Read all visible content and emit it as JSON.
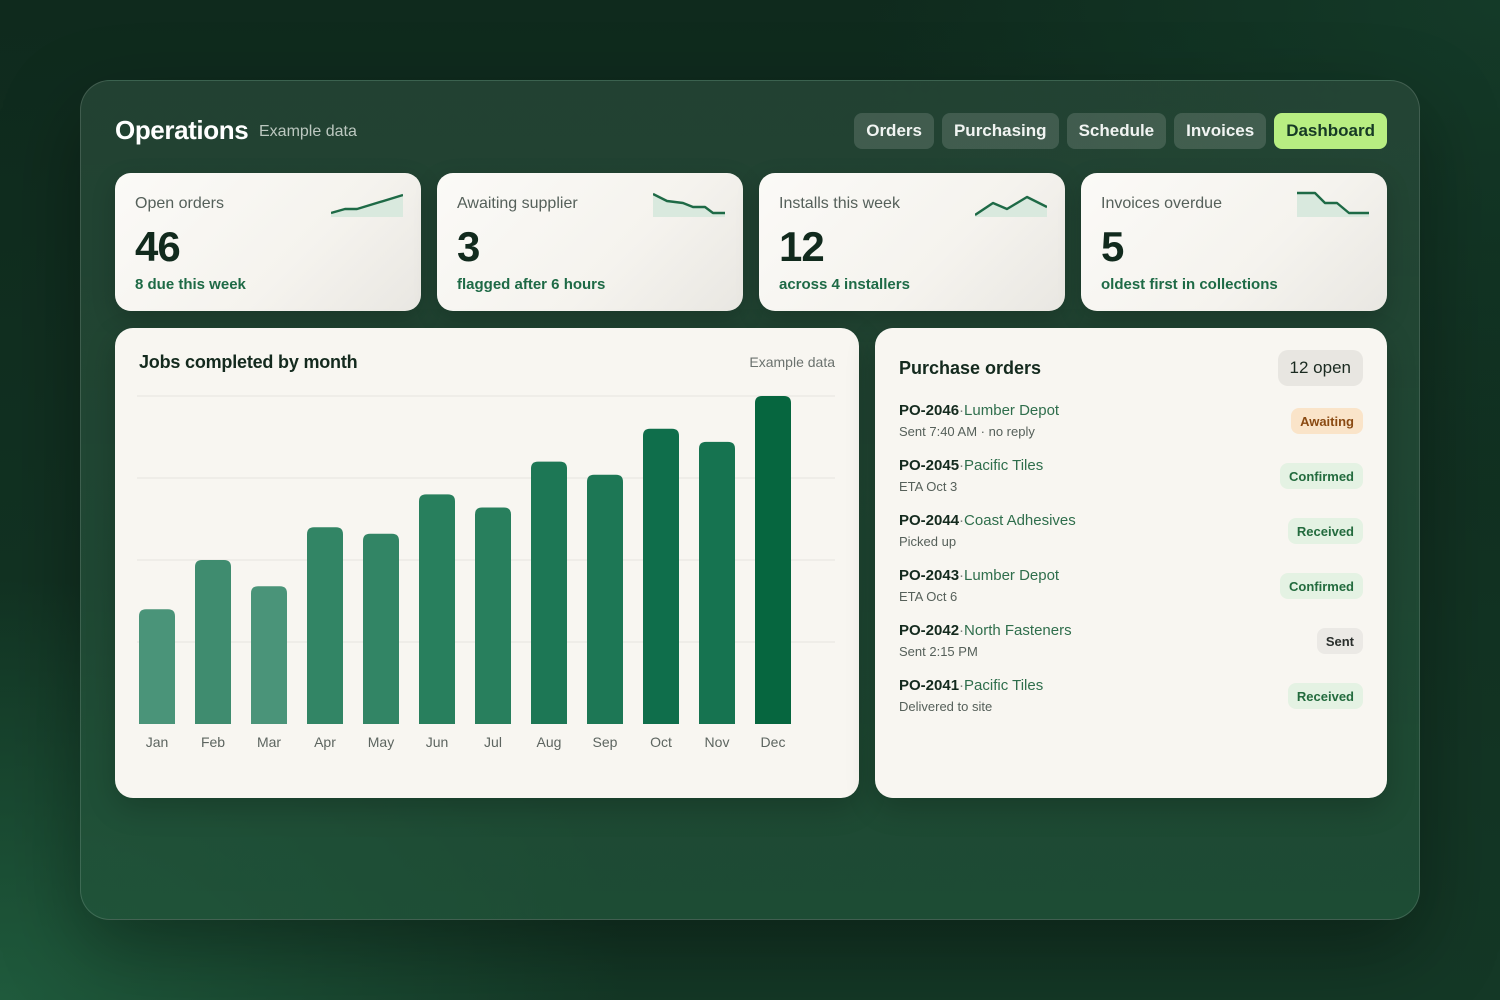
{
  "header": {
    "title": "Operations",
    "subtitle": "Example data",
    "tabs": [
      "Orders",
      "Purchasing",
      "Schedule",
      "Invoices",
      "Dashboard"
    ],
    "active_tab": "Dashboard"
  },
  "stats": [
    {
      "label": "Open orders",
      "value": "46",
      "note": "8 due this week",
      "trend": "up"
    },
    {
      "label": "Awaiting supplier",
      "value": "3",
      "note": "flagged after 6 hours",
      "trend": "down"
    },
    {
      "label": "Installs this week",
      "value": "12",
      "note": "across 4 installers",
      "trend": "wave"
    },
    {
      "label": "Invoices overdue",
      "value": "5",
      "note": "oldest first in collections",
      "trend": "down"
    }
  ],
  "chart": {
    "title": "Jobs completed by month",
    "tag": "Example data"
  },
  "chart_data": {
    "type": "bar",
    "categories": [
      "Jan",
      "Feb",
      "Mar",
      "Apr",
      "May",
      "Jun",
      "Jul",
      "Aug",
      "Sep",
      "Oct",
      "Nov",
      "Dec"
    ],
    "values": [
      35,
      50,
      42,
      60,
      58,
      70,
      66,
      80,
      76,
      90,
      86,
      100
    ],
    "ylim": [
      0,
      100
    ],
    "grid": true,
    "colors": [
      "#4a9479",
      "#3f8c6f",
      "#4a9479",
      "#328565",
      "#328565",
      "#287f5d",
      "#287f5d",
      "#1d7755",
      "#1d7755",
      "#0f6e4b",
      "#167350",
      "#06663f"
    ]
  },
  "purchase_orders": {
    "title": "Purchase orders",
    "count": "12 open",
    "items": [
      {
        "id": "PO-2046",
        "supplier": "Lumber Depot",
        "detail": "Sent 7:40 AM · no reply",
        "status": "Awaiting",
        "tone": "awaiting"
      },
      {
        "id": "PO-2045",
        "supplier": "Pacific Tiles",
        "detail": "ETA Oct 3",
        "status": "Confirmed",
        "tone": "green"
      },
      {
        "id": "PO-2044",
        "supplier": "Coast Adhesives",
        "detail": "Picked up",
        "status": "Received",
        "tone": "green"
      },
      {
        "id": "PO-2043",
        "supplier": "Lumber Depot",
        "detail": "ETA Oct 6",
        "status": "Confirmed",
        "tone": "green"
      },
      {
        "id": "PO-2042",
        "supplier": "North Fasteners",
        "detail": "Sent 2:15 PM",
        "status": "Sent",
        "tone": "neutral"
      },
      {
        "id": "PO-2041",
        "supplier": "Pacific Tiles",
        "detail": "Delivered to site",
        "status": "Received",
        "tone": "green"
      }
    ]
  },
  "colors": {
    "accent": "#b8ee82",
    "brand_green": "#06663f",
    "spark_line": "#1e6a46"
  }
}
